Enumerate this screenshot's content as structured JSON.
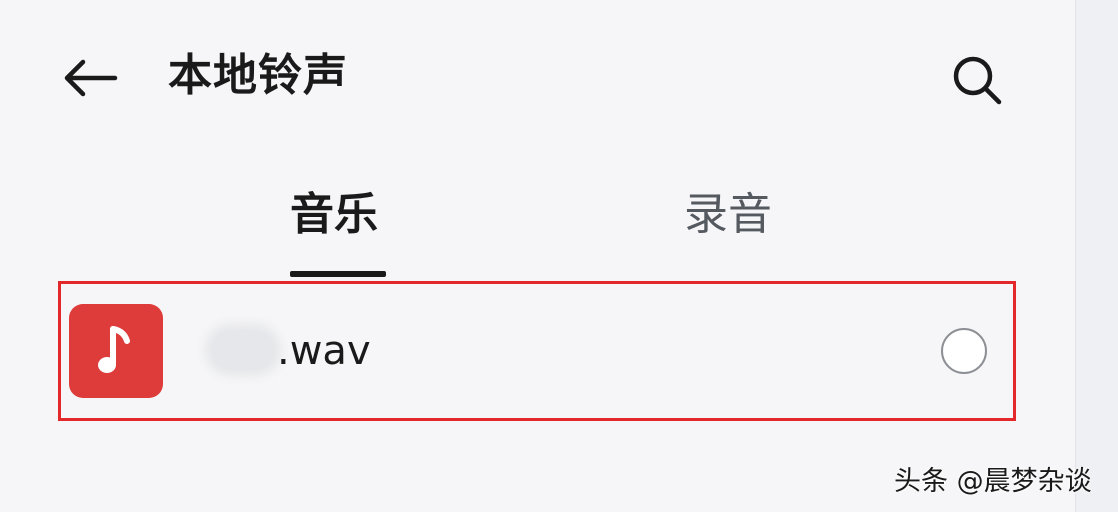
{
  "header": {
    "back_icon": "arrow-left-icon",
    "title": "本地铃声",
    "search_icon": "search-icon"
  },
  "tabs": [
    {
      "label": "音乐",
      "active": true
    },
    {
      "label": "录音",
      "active": false
    }
  ],
  "list": {
    "items": [
      {
        "icon": "music-note-icon",
        "file_extension": ".wav",
        "selected": false,
        "highlight_color": "#e3282b"
      }
    ]
  },
  "watermark": {
    "text": "头条 @晨梦杂谈"
  },
  "colors": {
    "accent_red": "#dd3c3b",
    "background": "#f6f6f8",
    "text_primary": "#1a1a1a",
    "text_secondary": "#555a60"
  }
}
